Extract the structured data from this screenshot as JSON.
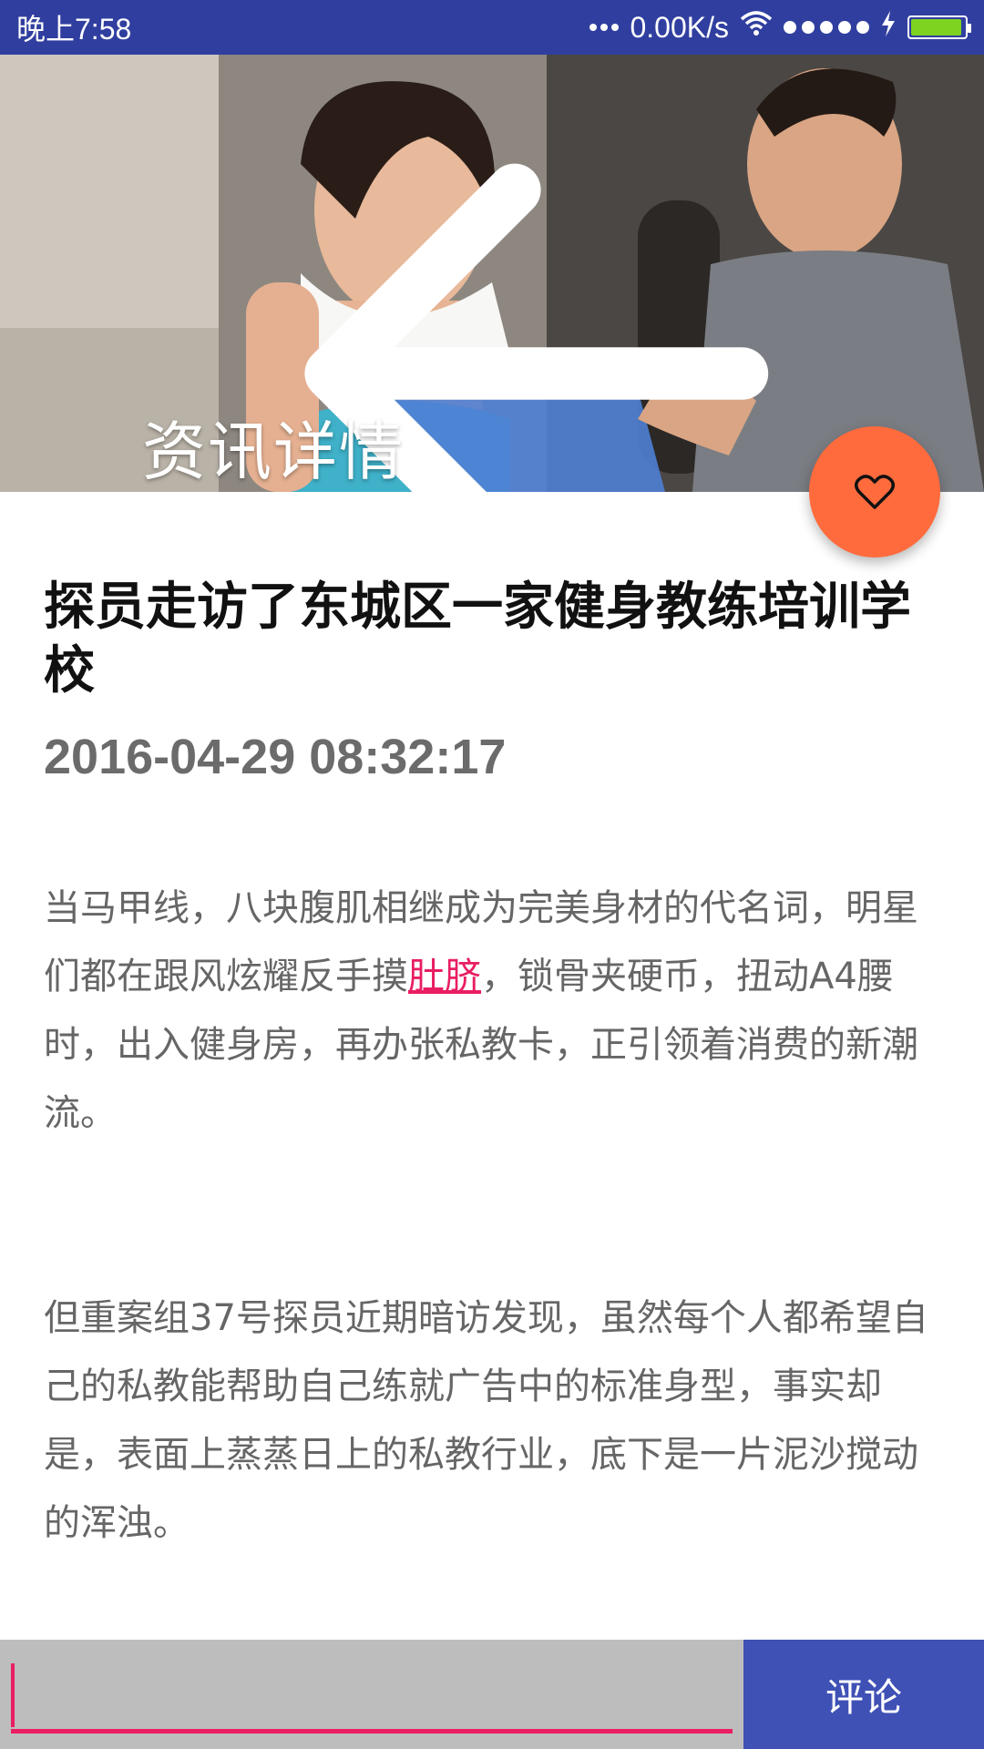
{
  "status_bar": {
    "time": "晚上7:58",
    "network_speed": "0.00K/s",
    "battery_color": "#7ed321",
    "battery_level": 0.95,
    "icons": [
      "dots-icon",
      "wifi-icon",
      "signal-icon",
      "charging-icon",
      "battery-icon"
    ]
  },
  "header": {
    "title": "资讯详情",
    "back_icon": "arrow-left-icon",
    "image": "fitness-trainer-photo"
  },
  "fab": {
    "icon": "heart-outline-icon",
    "color": "#ff6b3d"
  },
  "article": {
    "title": "探员走访了东城区一家健身教练培训学校",
    "date": "2016-04-29 08:32:17",
    "paragraph1_before_link": "当马甲线，八块腹肌相继成为完美身材的代名词，明星们都在跟风炫耀反手摸",
    "paragraph1_link": "肚脐",
    "paragraph1_after_link": "，锁骨夹硬币，扭动A4腰时，出入健身房，再办张私教卡，正引领着消费的新潮流。",
    "paragraph2": "但重案组37号探员近期暗访发现，虽然每个人都希望自己的私教能帮助自己练就广告中的标准身型，事实却是，表面上蒸蒸日上的私教行业，底下是一片泥沙搅动的浑浊。",
    "link_color": "#e91e63"
  },
  "comment_bar": {
    "input_value": "",
    "button_label": "评论",
    "accent_color": "#e91e63",
    "button_color": "#3f51b5"
  }
}
